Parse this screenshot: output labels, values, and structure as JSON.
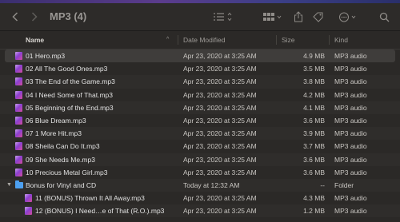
{
  "window": {
    "title": "MP3 (4)"
  },
  "toolbar": {
    "back_icon": "chevron-left-icon",
    "forward_icon": "chevron-right-icon",
    "view_icon": "list-view-icon",
    "group_icon": "grid-view-icon",
    "share_icon": "share-icon",
    "tag_icon": "tag-icon",
    "more_icon": "ellipsis-circle-icon",
    "search_icon": "search-icon"
  },
  "columns": {
    "name": "Name",
    "date": "Date Modified",
    "size": "Size",
    "kind": "Kind"
  },
  "colors": {
    "selected_row": "#3f3d3b",
    "background": "#2b2927",
    "folder": "#4da0f0"
  },
  "files": [
    {
      "name": "01 Hero.mp3",
      "date": "Apr 23, 2020 at 3:25 AM",
      "size": "4.9 MB",
      "kind": "MP3 audio"
    },
    {
      "name": "02 All The Good Ones.mp3",
      "date": "Apr 23, 2020 at 3:25 AM",
      "size": "3.5 MB",
      "kind": "MP3 audio"
    },
    {
      "name": "03 The End of the Game.mp3",
      "date": "Apr 23, 2020 at 3:25 AM",
      "size": "3.8 MB",
      "kind": "MP3 audio"
    },
    {
      "name": "04 I Need Some of That.mp3",
      "date": "Apr 23, 2020 at 3:25 AM",
      "size": "4.2 MB",
      "kind": "MP3 audio"
    },
    {
      "name": "05 Beginning of the End.mp3",
      "date": "Apr 23, 2020 at 3:25 AM",
      "size": "4.1 MB",
      "kind": "MP3 audio"
    },
    {
      "name": "06 Blue Dream.mp3",
      "date": "Apr 23, 2020 at 3:25 AM",
      "size": "3.6 MB",
      "kind": "MP3 audio"
    },
    {
      "name": "07 1 More Hit.mp3",
      "date": "Apr 23, 2020 at 3:25 AM",
      "size": "3.9 MB",
      "kind": "MP3 audio"
    },
    {
      "name": "08 Sheila Can Do It.mp3",
      "date": "Apr 23, 2020 at 3:25 AM",
      "size": "3.7 MB",
      "kind": "MP3 audio"
    },
    {
      "name": "09 She Needs Me.mp3",
      "date": "Apr 23, 2020 at 3:25 AM",
      "size": "3.6 MB",
      "kind": "MP3 audio"
    },
    {
      "name": "10 Precious Metal Girl.mp3",
      "date": "Apr 23, 2020 at 3:25 AM",
      "size": "3.6 MB",
      "kind": "MP3 audio"
    }
  ],
  "folder": {
    "name": "Bonus for Vinyl and CD",
    "date": "Today at 12:32 AM",
    "size": "--",
    "kind": "Folder"
  },
  "subfiles": [
    {
      "name": "11 (BONUS) Thrown It All Away.mp3",
      "date": "Apr 23, 2020 at 3:25 AM",
      "size": "4.3 MB",
      "kind": "MP3 audio"
    },
    {
      "name": "12 (BONUS) I Need…e of That (R.O.).mp3",
      "date": "Apr 23, 2020 at 3:25 AM",
      "size": "1.2 MB",
      "kind": "MP3 audio"
    }
  ]
}
